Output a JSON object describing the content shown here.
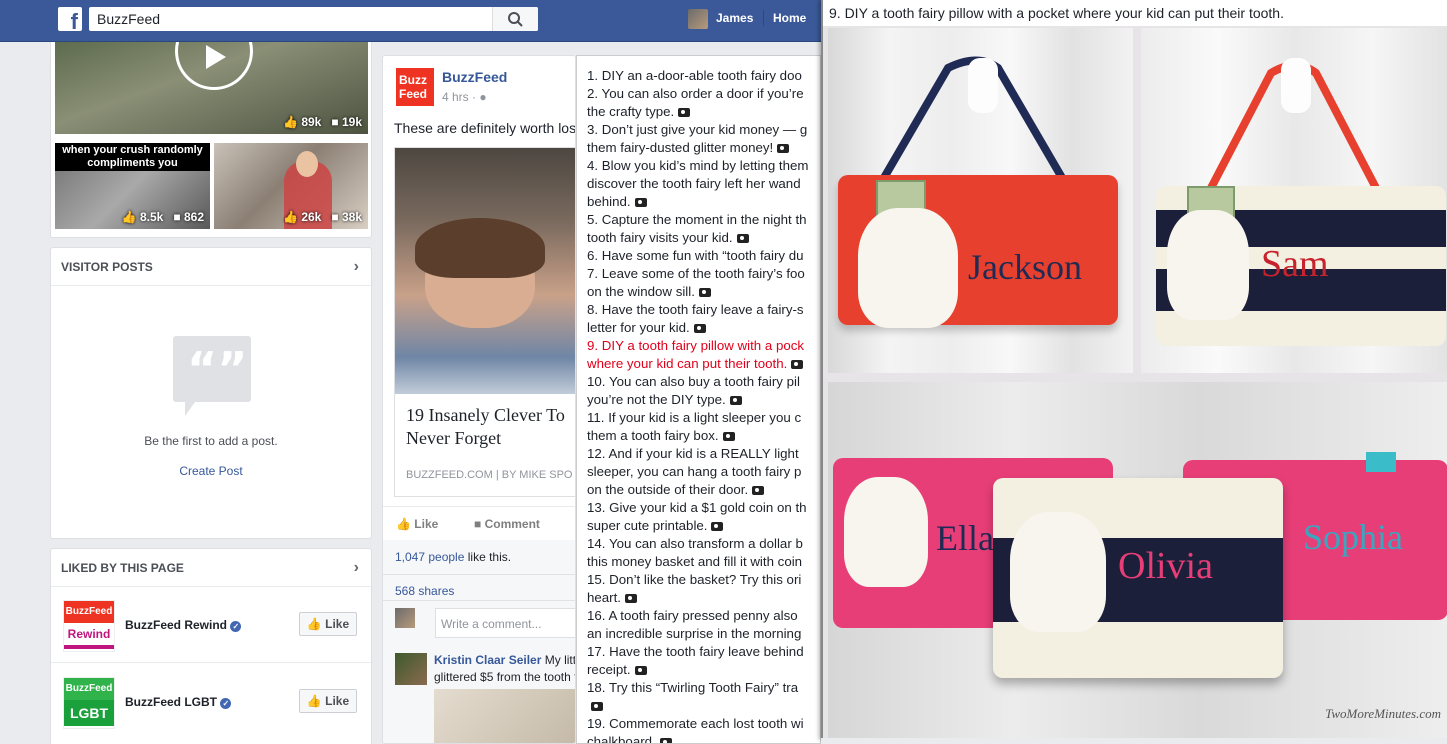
{
  "topbar": {
    "search_value": "BuzzFeed",
    "user_name": "James",
    "home_label": "Home"
  },
  "left": {
    "videos": [
      {
        "likes": "89k",
        "comments": "19k"
      },
      {
        "caption": "when your crush randomly compliments you",
        "likes": "8.5k",
        "comments": "862"
      },
      {
        "likes": "26k",
        "comments": "38k"
      }
    ],
    "visitor_posts": {
      "title": "VISITOR POSTS",
      "empty_text": "Be the first to add a post.",
      "create_link": "Create Post"
    },
    "liked_by": {
      "title": "LIKED BY THIS PAGE",
      "pages": [
        {
          "name": "BuzzFeed Rewind",
          "logo_top": "BuzzFeed",
          "logo_bottom": "Rewind",
          "like_label": "Like"
        },
        {
          "name": "BuzzFeed LGBT",
          "logo_top": "BuzzFeed",
          "logo_bottom": "LGBT",
          "like_label": "Like"
        }
      ]
    }
  },
  "post": {
    "page_name": "BuzzFeed",
    "time": "4 hrs ·",
    "text": "These are definitely worth los",
    "link_title_1": "19 Insanely Clever To",
    "link_title_2": "Never Forget",
    "link_source": "BUZZFEED.COM",
    "link_author": "| BY MIKE SPO",
    "like_label": "Like",
    "comment_label": "Comment",
    "likes_count": "1,047 people",
    "likes_suffix": "like this.",
    "shares": "568 shares",
    "comment_placeholder": "Write a comment...",
    "commenter": "Kristin Claar Seiler",
    "comment_text_1": "My litt",
    "comment_text_2": "glittered $5 from the tooth f"
  },
  "list": {
    "items": [
      {
        "text": "1. DIY an a-door-able tooth fairy doo",
        "cam": false,
        "red": false
      },
      {
        "text": "2. You can also order a door if you’re",
        "cam": false,
        "red": false
      },
      {
        "text": "the crafty type.",
        "cam": true,
        "red": false
      },
      {
        "text": "3. Don’t just give your kid money — g",
        "cam": false,
        "red": false
      },
      {
        "text": "them fairy-dusted glitter money!",
        "cam": true,
        "red": false
      },
      {
        "text": "4. Blow you kid’s mind by letting them",
        "cam": false,
        "red": false
      },
      {
        "text": "discover the tooth fairy left her wand",
        "cam": false,
        "red": false
      },
      {
        "text": "behind.",
        "cam": true,
        "red": false
      },
      {
        "text": "5. Capture the moment in the night th",
        "cam": false,
        "red": false
      },
      {
        "text": "tooth fairy visits your kid.",
        "cam": true,
        "red": false
      },
      {
        "text": "6. Have some fun with “tooth fairy du",
        "cam": false,
        "red": false
      },
      {
        "text": "7. Leave some of the tooth fairy’s foo",
        "cam": false,
        "red": false
      },
      {
        "text": "on the window sill.",
        "cam": true,
        "red": false
      },
      {
        "text": "8. Have the tooth fairy leave a fairy-s",
        "cam": false,
        "red": false
      },
      {
        "text": "letter for your kid.",
        "cam": true,
        "red": false
      },
      {
        "text": "9. DIY a tooth fairy pillow with a pock",
        "cam": false,
        "red": true
      },
      {
        "text": "where your kid can put their tooth.",
        "cam": true,
        "red": true
      },
      {
        "text": "10. You can also buy a tooth fairy pil",
        "cam": false,
        "red": false
      },
      {
        "text": "you’re not the DIY type.",
        "cam": true,
        "red": false
      },
      {
        "text": "11. If your kid is a light sleeper you c",
        "cam": false,
        "red": false
      },
      {
        "text": "them a tooth fairy box.",
        "cam": true,
        "red": false
      },
      {
        "text": "12. And if your kid is a REALLY light",
        "cam": false,
        "red": false
      },
      {
        "text": "sleeper, you can hang a tooth fairy p",
        "cam": false,
        "red": false
      },
      {
        "text": "on the outside of their door.",
        "cam": true,
        "red": false
      },
      {
        "text": "13. Give your kid a $1 gold coin on th",
        "cam": false,
        "red": false
      },
      {
        "text": "super cute printable.",
        "cam": true,
        "red": false
      },
      {
        "text": "14. You can also transform a dollar b",
        "cam": false,
        "red": false
      },
      {
        "text": "this money basket and fill it with coin",
        "cam": false,
        "red": false
      },
      {
        "text": "15. Don’t like the basket? Try this ori",
        "cam": false,
        "red": false
      },
      {
        "text": "heart.",
        "cam": true,
        "red": false
      },
      {
        "text": "16. A tooth fairy pressed penny also",
        "cam": false,
        "red": false
      },
      {
        "text": "an incredible surprise in the morning",
        "cam": false,
        "red": false
      },
      {
        "text": "17. Have the tooth fairy leave behind",
        "cam": false,
        "red": false
      },
      {
        "text": "receipt.",
        "cam": true,
        "red": false
      },
      {
        "text": "18. Try this “Twirling Tooth Fairy” tra",
        "cam": false,
        "red": false
      },
      {
        "text": "",
        "cam": true,
        "red": false
      },
      {
        "text": "19. Commemorate each lost tooth wi",
        "cam": false,
        "red": false
      },
      {
        "text": "chalkboard.",
        "cam": true,
        "red": false
      }
    ]
  },
  "photo": {
    "caption": "9. DIY a tooth fairy pillow with a pocket where your kid can put their tooth.",
    "names": [
      "Jackson",
      "Sam",
      "Ella",
      "Olivia",
      "Sophia"
    ],
    "watermark": "TwoMoreMinutes.com"
  },
  "colors": {
    "fb_blue": "#3b5998",
    "link": "#365899",
    "highlight_red": "#e0001b"
  }
}
